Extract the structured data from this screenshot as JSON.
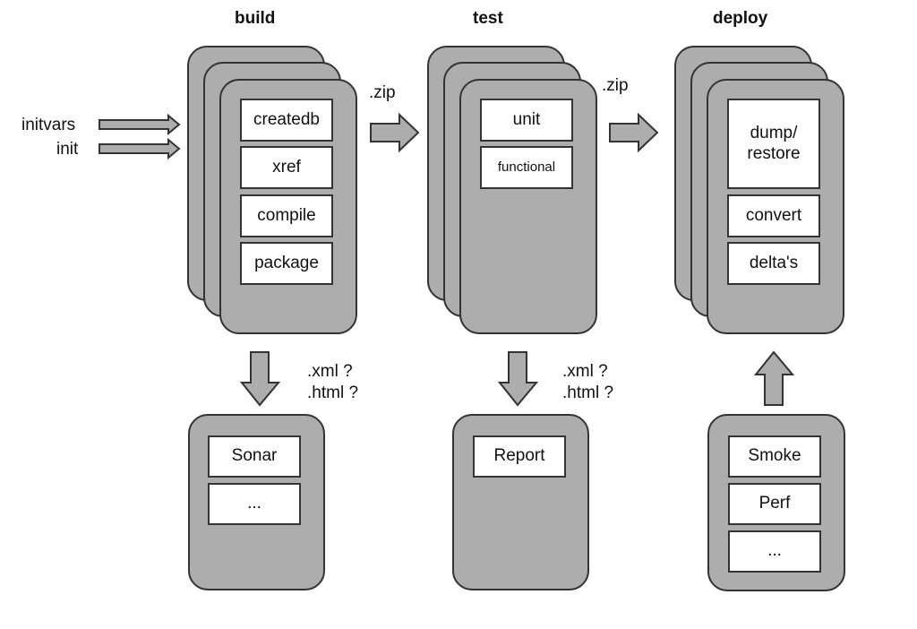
{
  "stages": [
    {
      "title": "build",
      "steps": [
        "createdb",
        "xref",
        "compile",
        "package"
      ]
    },
    {
      "title": "test",
      "steps": [
        "unit",
        "functional"
      ]
    },
    {
      "title": "deploy",
      "steps": [
        "dump/\nrestore",
        "convert",
        "delta's"
      ]
    }
  ],
  "inputs": [
    "initvars",
    "init"
  ],
  "artifacts": [
    ".zip",
    ".zip"
  ],
  "reports": [
    {
      "formats": [
        ".xml ?",
        ".html ?"
      ],
      "items": [
        "Sonar",
        "..."
      ]
    },
    {
      "formats": [
        ".xml ?",
        ".html ?"
      ],
      "items": [
        "Report"
      ]
    },
    {
      "items": [
        "Smoke",
        "Perf",
        "..."
      ]
    }
  ],
  "colors": {
    "card_fill": "#adadad",
    "stroke": "#333333",
    "box_fill": "#ffffff"
  }
}
